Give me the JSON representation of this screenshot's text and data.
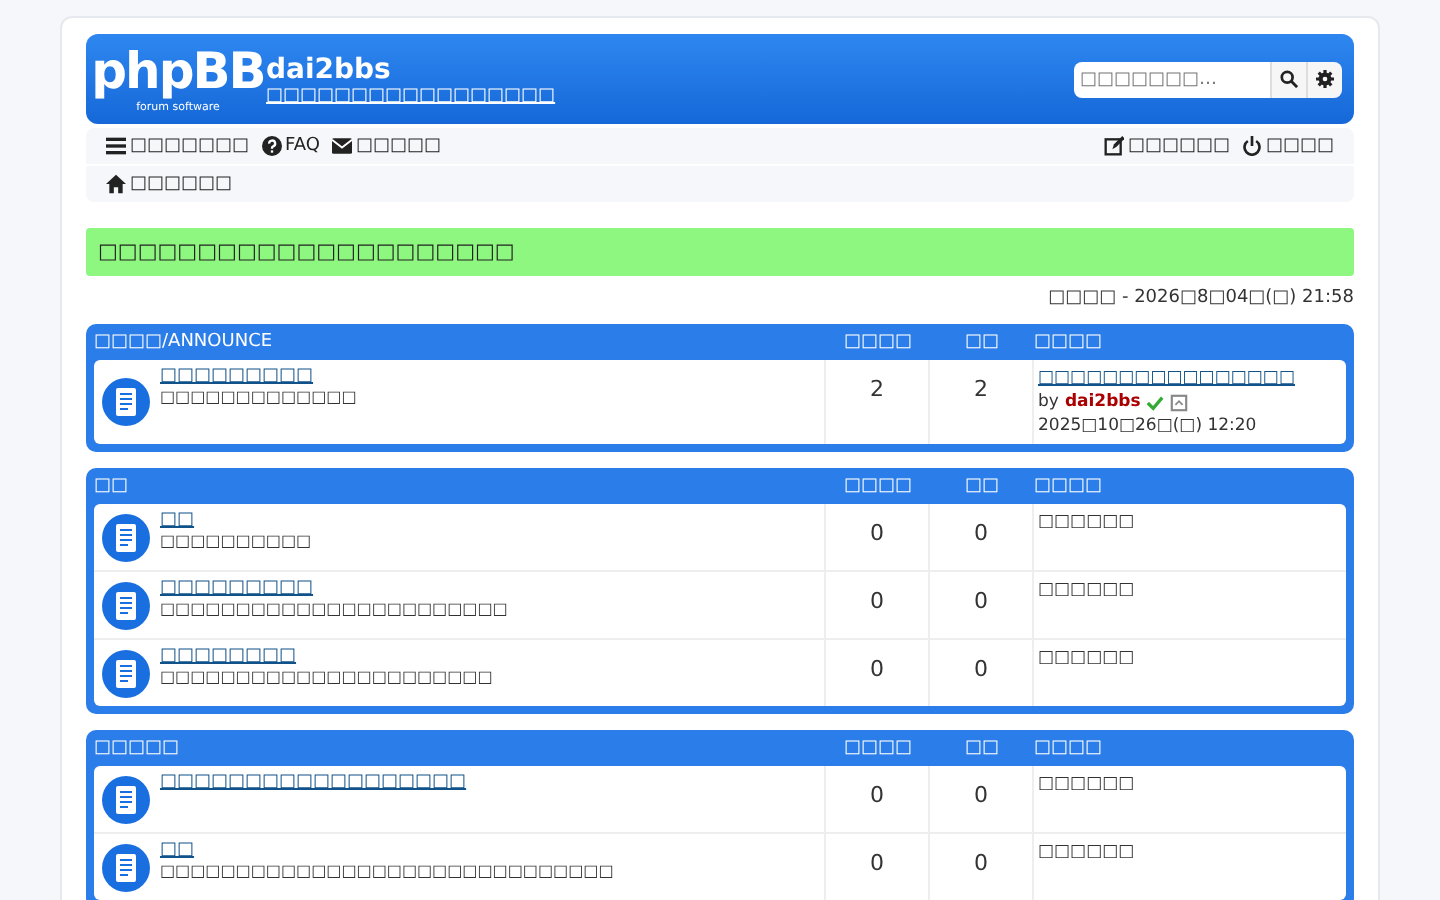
{
  "header": {
    "logo": {
      "text": "phpBB",
      "tagline": "forum software"
    },
    "site_title": "dai2bbs",
    "site_description": "□□□□□□□□□□□□□□□□□",
    "search": {
      "placeholder": "□□□□□□□…"
    }
  },
  "nav": {
    "left": [
      {
        "kind": "menu",
        "label": "□□□□□□□"
      },
      {
        "kind": "faq",
        "label": "FAQ"
      },
      {
        "kind": "mail",
        "label": "□□□□□"
      }
    ],
    "right": [
      {
        "kind": "register",
        "label": "□□□□□□"
      },
      {
        "kind": "login",
        "label": "□□□□"
      }
    ]
  },
  "breadcrumb": {
    "label": "□□□□□□"
  },
  "banner": "□□□□□□□□□□□□□□□□□□□□□",
  "current_time": "□□□□ - 2026□8□04□(□) 21:58",
  "categories": [
    {
      "title": "□□□□/ANNOUNCE",
      "columns": [
        "□□□□",
        "□□",
        "□□□□"
      ],
      "forums": [
        {
          "name": "□□□□□□□□□",
          "description": "□□□□□□□□□□□□□",
          "topics": "2",
          "posts": "2",
          "last_post": {
            "kind": "post",
            "title": "□□□□□□□□□□□□□□□□",
            "prefix": "by",
            "author": "dai2bbs",
            "date": "2025□10□26□(□) 12:20"
          }
        }
      ]
    },
    {
      "title": "□□",
      "columns": [
        "□□□□",
        "□□",
        "□□□□"
      ],
      "forums": [
        {
          "name": "□□",
          "description": "□□□□□□□□□□",
          "topics": "0",
          "posts": "0",
          "last_post": {
            "kind": "empty",
            "text": "□□□□□□"
          }
        },
        {
          "name": "□□□□□□□□□",
          "description": "□□□□□□□□□□□□□□□□□□□□□□□",
          "topics": "0",
          "posts": "0",
          "last_post": {
            "kind": "empty",
            "text": "□□□□□□"
          }
        },
        {
          "name": "□□□□□□□□",
          "description": "□□□□□□□□□□□□□□□□□□□□□□",
          "topics": "0",
          "posts": "0",
          "last_post": {
            "kind": "empty",
            "text": "□□□□□□"
          }
        }
      ]
    },
    {
      "title": "□□□□□",
      "columns": [
        "□□□□",
        "□□",
        "□□□□"
      ],
      "forums": [
        {
          "name": "□□□□□□□□□□□□□□□□□□",
          "topics": "0",
          "posts": "0",
          "last_post": {
            "kind": "empty",
            "text": "□□□□□□"
          }
        },
        {
          "name": "□□",
          "description": "□□□□□□□□□□□□□□□□□□□□□□□□□□□□□□",
          "topics": "0",
          "posts": "0",
          "last_post": {
            "kind": "empty",
            "text": "□□□□□□"
          }
        }
      ]
    }
  ]
}
